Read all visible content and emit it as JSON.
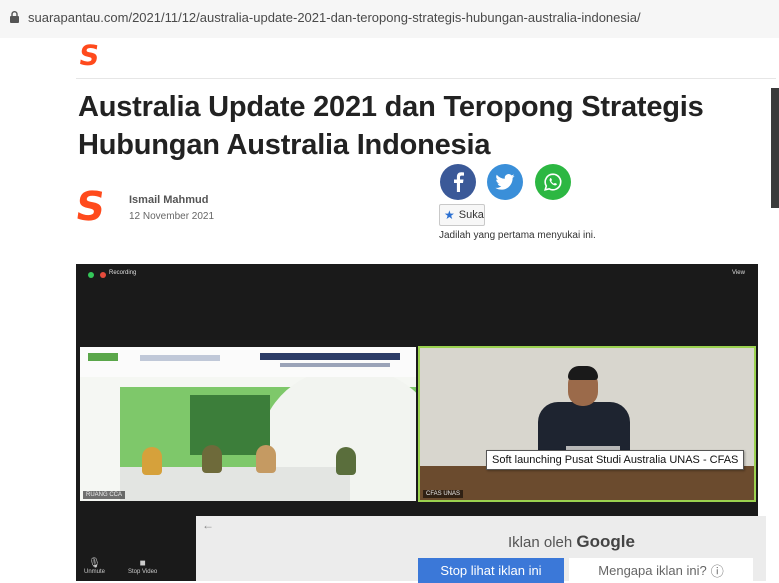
{
  "browser": {
    "url": "suarapantau.com/2021/11/12/australia-update-2021-dan-teropong-strategis-hubungan-australia-indonesia/"
  },
  "site": {
    "logo": "S"
  },
  "article": {
    "title_line1": "Australia Update 2021 dan Teropong Strategis",
    "title_line2": "Hubungan Australia Indonesia",
    "author": "Ismail Mahmud",
    "date": "12 November 2021"
  },
  "social": {
    "like_label": "Suka",
    "like_note": "Jadilah yang pertama menyukai ini."
  },
  "video": {
    "recording_label": "Recording",
    "view_label": "View",
    "left_tile_label": "RUANG CCA",
    "right_tile_label": "CFAS UNAS",
    "tooltip": "Soft launching Pusat Studi Australia UNAS - CFAS",
    "controls": [
      "Unmute",
      "Stop Video"
    ]
  },
  "ad": {
    "by_text": "Iklan oleh",
    "by_brand": "Google",
    "stop_button": "Stop lihat iklan ini",
    "why_button": "Mengapa iklan ini?"
  },
  "colors": {
    "brand": "#ff4a1c",
    "facebook": "#3b5998",
    "twitter": "#3a8fd9",
    "whatsapp": "#2cb742",
    "stop_button": "#3b78d8"
  }
}
